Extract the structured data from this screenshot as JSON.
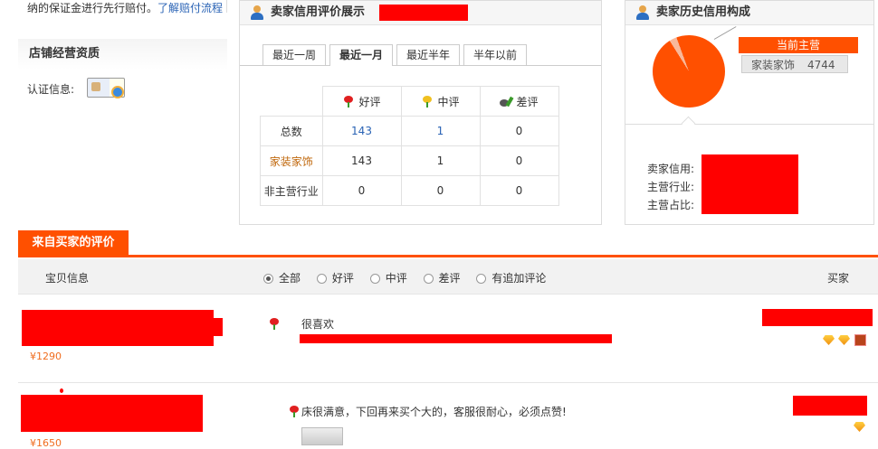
{
  "top_note": {
    "text": "纳的保证金进行先行赔付。",
    "link": "了解赔付流程"
  },
  "qualification": {
    "title": "店铺经营资质",
    "cert_label": "认证信息:"
  },
  "credit_panel": {
    "title": "卖家信用评价展示",
    "tabs": [
      "最近一周",
      "最近一月",
      "最近半年",
      "半年以前"
    ],
    "active_tab": "最近一月",
    "headers": [
      "好评",
      "中评",
      "差评"
    ],
    "rows": [
      {
        "label": "总数",
        "good": "143",
        "neutral": "1",
        "bad": "0"
      },
      {
        "label": "家装家饰",
        "good": "143",
        "neutral": "1",
        "bad": "0"
      },
      {
        "label": "非主营行业",
        "good": "0",
        "neutral": "0",
        "bad": "0"
      }
    ]
  },
  "history_panel": {
    "title": "卖家历史信用构成",
    "legend_main": "当前主营",
    "legend_category": "家装家饰",
    "legend_value": "4744",
    "labels": [
      "卖家信用:",
      "主营行业:",
      "主营占比:"
    ]
  },
  "reviews": {
    "section_title": "来自买家的评价",
    "col_item": "宝贝信息",
    "col_buyer": "买家",
    "filters": [
      "全部",
      "好评",
      "中评",
      "差评",
      "有追加评论"
    ],
    "items": [
      {
        "price": "¥1290",
        "comment": "很喜欢"
      },
      {
        "price": "¥1650",
        "comment": "床很满意，下回再来买个大的，客服很耐心，必须点赞!"
      }
    ]
  },
  "colors": {
    "accent": "#ff5000",
    "link": "#2a63b5",
    "category": "#c0680d"
  }
}
